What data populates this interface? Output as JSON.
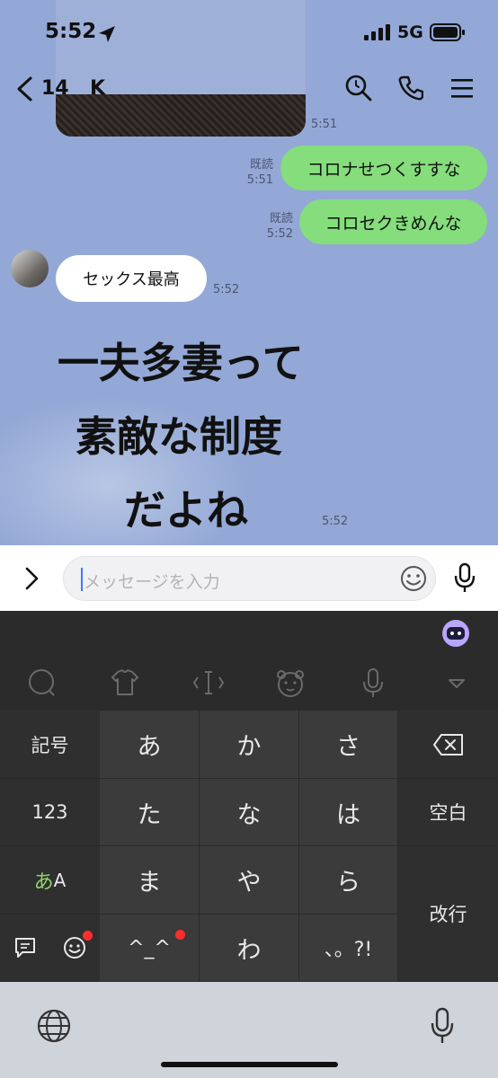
{
  "status": {
    "time": "5:52",
    "network": "5G"
  },
  "header": {
    "back_count": "14",
    "contact_name": "K"
  },
  "messages": {
    "image_time": "5:51",
    "m1": {
      "text": "コロナせつくすすな",
      "read": "既読",
      "time": "5:51"
    },
    "m2": {
      "text": "コロセクきめんな",
      "read": "既読",
      "time": "5:52"
    },
    "m3": {
      "text": "セックス最高",
      "time": "5:52"
    },
    "sticker": {
      "lines": [
        "一夫多妻って",
        "素敵な制度",
        "だよね"
      ],
      "time": "5:52"
    }
  },
  "input": {
    "placeholder": "メッセージを入力"
  },
  "keyboard": {
    "left_keys": [
      "記号",
      "123",
      "あA"
    ],
    "kana_keys": [
      "あ",
      "か",
      "さ",
      "た",
      "な",
      "は",
      "ま",
      "や",
      "ら",
      "^_^",
      "わ",
      "、。?!"
    ],
    "space_label": "空白",
    "enter_label": "改行",
    "kana_prefix": "あ",
    "alpha_suffix": "A"
  },
  "colors": {
    "chat_bg": "#93a8d6",
    "green_bubble": "#85dd7c",
    "keyboard_bg": "#2b2b2b",
    "badge_red": "#ff2d2d"
  }
}
